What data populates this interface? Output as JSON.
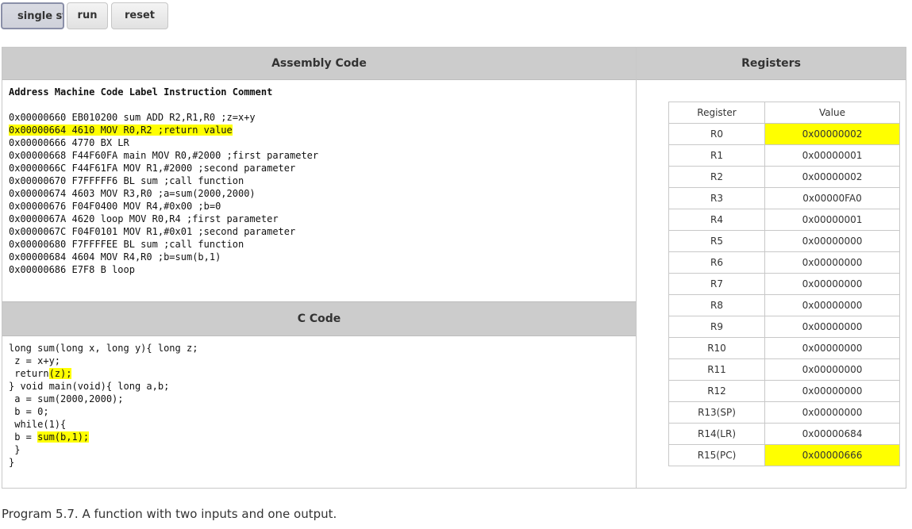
{
  "toolbar": {
    "step_label": "single step",
    "run_label": "run",
    "reset_label": "reset"
  },
  "assembly": {
    "title": "Assembly Code",
    "header": "Address Machine Code Label Instruction Comment",
    "lines": [
      {
        "text": "0x00000660 EB010200 sum ADD R2,R1,R0 ;z=x+y",
        "highlight": false
      },
      {
        "text": "0x00000664 4610 MOV R0,R2 ;return value",
        "highlight": true
      },
      {
        "text": "0x00000666 4770 BX LR",
        "highlight": false
      },
      {
        "text": "0x00000668 F44F60FA main MOV R0,#2000 ;first parameter",
        "highlight": false
      },
      {
        "text": "0x0000066C F44F61FA MOV R1,#2000 ;second parameter",
        "highlight": false
      },
      {
        "text": "0x00000670 F7FFFFF6 BL sum ;call function",
        "highlight": false
      },
      {
        "text": "0x00000674 4603 MOV R3,R0 ;a=sum(2000,2000)",
        "highlight": false
      },
      {
        "text": "0x00000676 F04F0400 MOV R4,#0x00 ;b=0",
        "highlight": false
      },
      {
        "text": "0x0000067A 4620 loop MOV R0,R4 ;first parameter",
        "highlight": false
      },
      {
        "text": "0x0000067C F04F0101 MOV R1,#0x01 ;second parameter",
        "highlight": false
      },
      {
        "text": "0x00000680 F7FFFFEE BL sum ;call function",
        "highlight": false
      },
      {
        "text": "0x00000684 4604 MOV R4,R0 ;b=sum(b,1)",
        "highlight": false
      },
      {
        "text": "0x00000686 E7F8 B loop",
        "highlight": false
      }
    ]
  },
  "ccode": {
    "title": "C Code",
    "lines": [
      {
        "pre": "long sum(long x, long y){ long z;",
        "hl": ""
      },
      {
        "pre": " z = x+y;",
        "hl": ""
      },
      {
        "pre": " return",
        "hl": "(z);"
      },
      {
        "pre": "} void main(void){ long a,b;",
        "hl": ""
      },
      {
        "pre": " a = sum(2000,2000);",
        "hl": ""
      },
      {
        "pre": " b = 0;",
        "hl": ""
      },
      {
        "pre": " while(1){",
        "hl": ""
      },
      {
        "pre": " b = ",
        "hl": "sum(b,1);"
      },
      {
        "pre": " }",
        "hl": ""
      },
      {
        "pre": "}",
        "hl": ""
      }
    ]
  },
  "registers": {
    "title": "Registers",
    "col_register": "Register",
    "col_value": "Value",
    "rows": [
      {
        "name": "R0",
        "value": "0x00000002",
        "highlight": true
      },
      {
        "name": "R1",
        "value": "0x00000001",
        "highlight": false
      },
      {
        "name": "R2",
        "value": "0x00000002",
        "highlight": false
      },
      {
        "name": "R3",
        "value": "0x00000FA0",
        "highlight": false
      },
      {
        "name": "R4",
        "value": "0x00000001",
        "highlight": false
      },
      {
        "name": "R5",
        "value": "0x00000000",
        "highlight": false
      },
      {
        "name": "R6",
        "value": "0x00000000",
        "highlight": false
      },
      {
        "name": "R7",
        "value": "0x00000000",
        "highlight": false
      },
      {
        "name": "R8",
        "value": "0x00000000",
        "highlight": false
      },
      {
        "name": "R9",
        "value": "0x00000000",
        "highlight": false
      },
      {
        "name": "R10",
        "value": "0x00000000",
        "highlight": false
      },
      {
        "name": "R11",
        "value": "0x00000000",
        "highlight": false
      },
      {
        "name": "R12",
        "value": "0x00000000",
        "highlight": false
      },
      {
        "name": "R13(SP)",
        "value": "0x00000000",
        "highlight": false
      },
      {
        "name": "R14(LR)",
        "value": "0x00000684",
        "highlight": false
      },
      {
        "name": "R15(PC)",
        "value": "0x00000666",
        "highlight": true
      }
    ]
  },
  "caption": "Program 5.7. A function with two inputs and one output.",
  "colors": {
    "highlight": "#ffff00",
    "header_bg": "#cccccc"
  }
}
